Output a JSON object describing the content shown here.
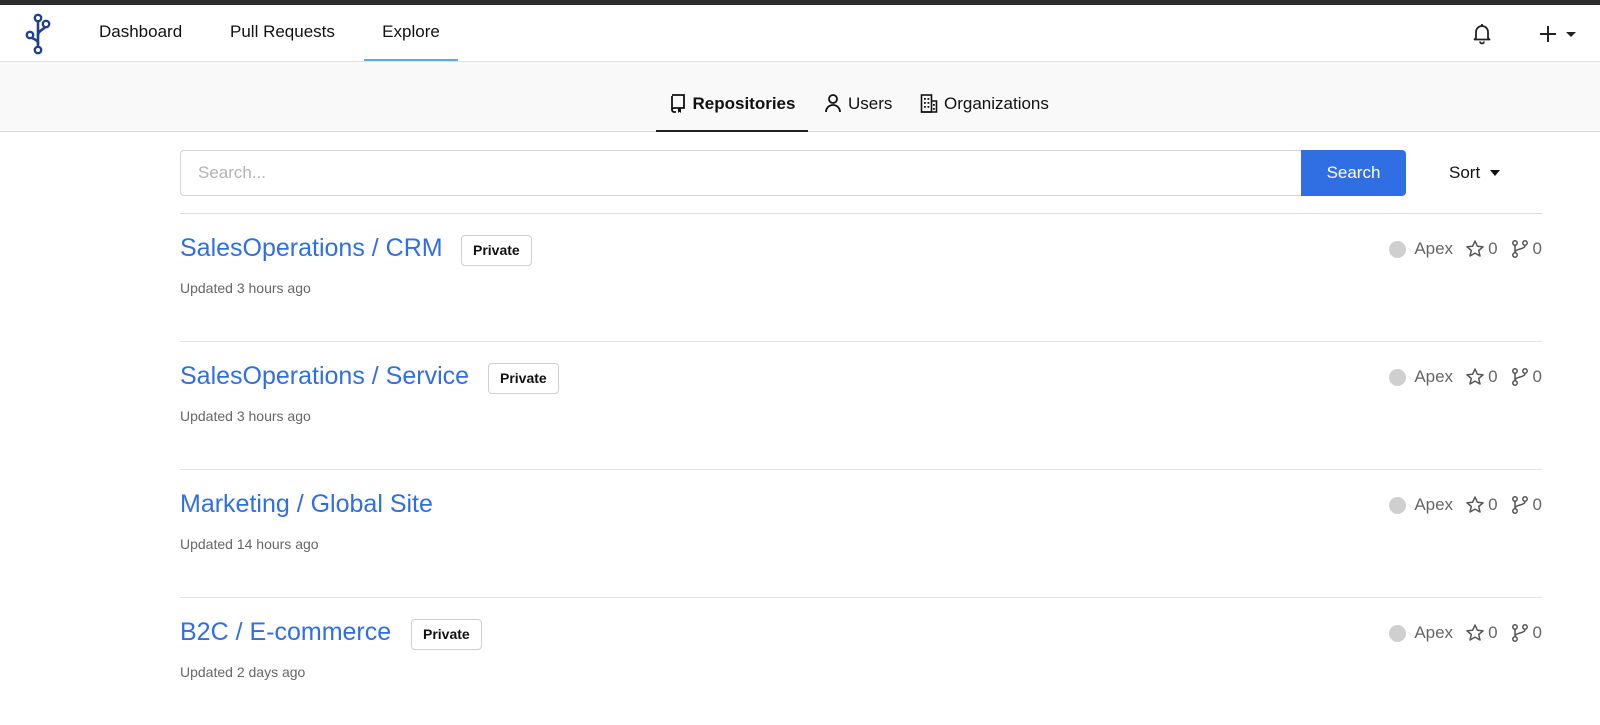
{
  "navbar": {
    "items": [
      {
        "label": "Dashboard"
      },
      {
        "label": "Pull Requests"
      },
      {
        "label": "Explore"
      }
    ]
  },
  "subnav": {
    "tabs": [
      {
        "label": "Repositories",
        "icon": "repo-icon"
      },
      {
        "label": "Users",
        "icon": "user-icon"
      },
      {
        "label": "Organizations",
        "icon": "organization-icon"
      }
    ]
  },
  "search": {
    "placeholder": "Search...",
    "value": "",
    "button_label": "Search",
    "sort_label": "Sort"
  },
  "repos": [
    {
      "title": "SalesOperations / CRM",
      "badge": "Private",
      "updated": "Updated 3 hours ago",
      "language": "Apex",
      "stars": "0",
      "forks": "0"
    },
    {
      "title": "SalesOperations / Service",
      "badge": "Private",
      "updated": "Updated 3 hours ago",
      "language": "Apex",
      "stars": "0",
      "forks": "0"
    },
    {
      "title": "Marketing / Global Site",
      "badge": "",
      "updated": "Updated 14 hours ago",
      "language": "Apex",
      "stars": "0",
      "forks": "0"
    },
    {
      "title": "B2C / E-commerce",
      "badge": "Private",
      "updated": "Updated 2 days ago",
      "language": "Apex",
      "stars": "0",
      "forks": "0"
    }
  ],
  "colors": {
    "accent": "#2f6ee3",
    "active_tab_underline": "#5ba8ea",
    "language_dot": "#cfcfcf",
    "logo": "#1f3f8f"
  }
}
